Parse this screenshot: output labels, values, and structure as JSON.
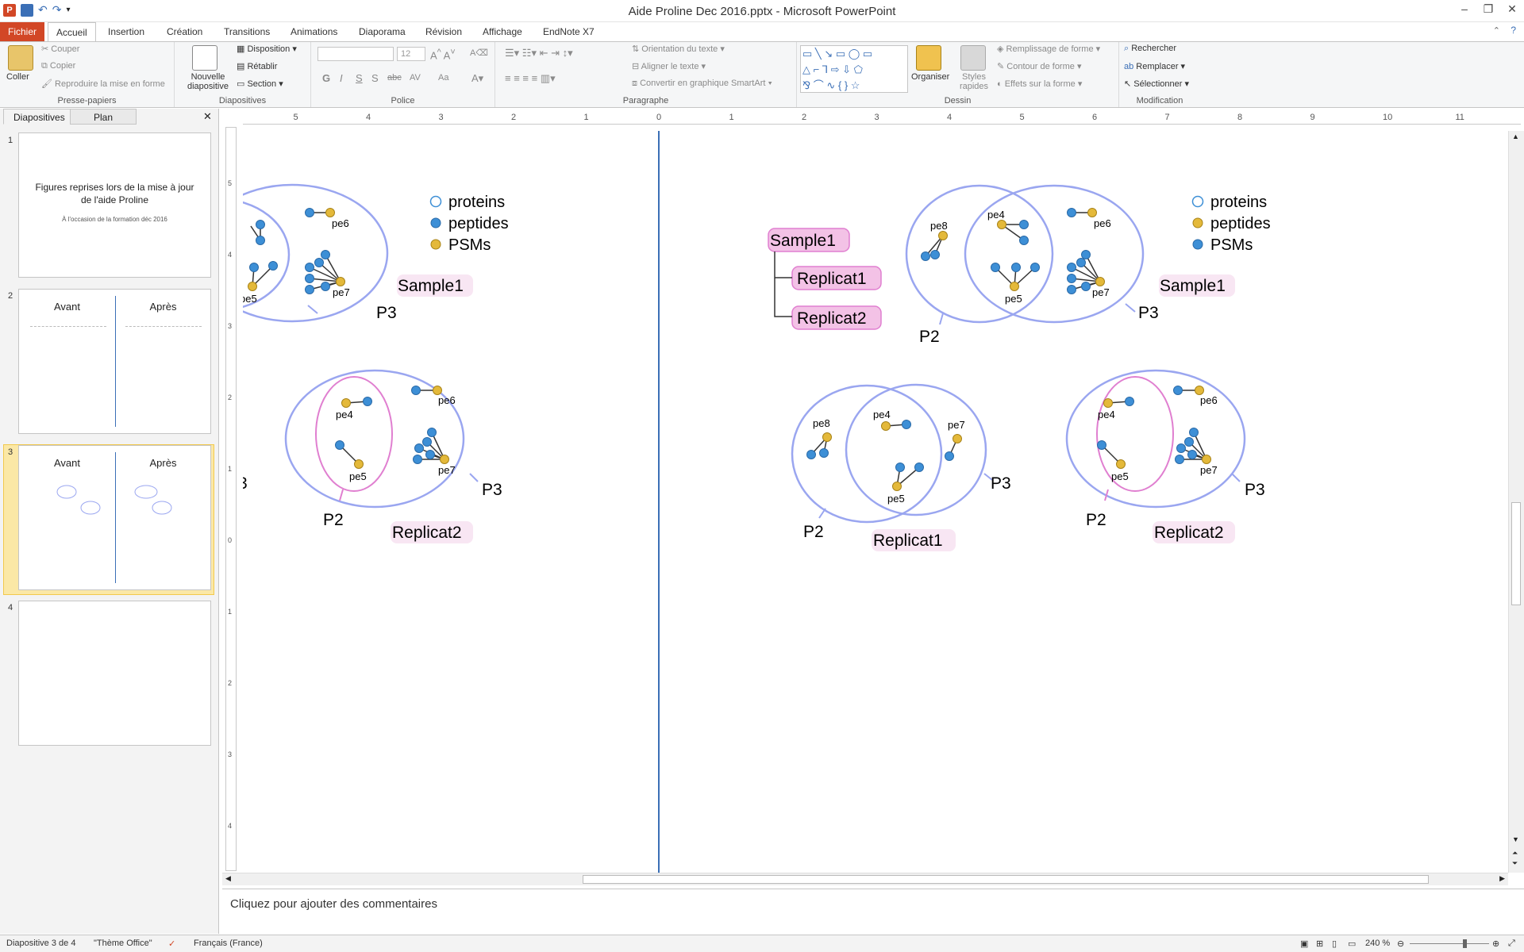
{
  "window": {
    "title": "Aide Proline Dec 2016.pptx - Microsoft PowerPoint"
  },
  "tabs": [
    "Fichier",
    "Accueil",
    "Insertion",
    "Création",
    "Transitions",
    "Animations",
    "Diaporama",
    "Révision",
    "Affichage",
    "EndNote X7"
  ],
  "ribbon": {
    "clipboard": {
      "paste": "Coller",
      "cut": "Couper",
      "copy": "Copier",
      "format_painter": "Reproduire la mise en forme",
      "label": "Presse-papiers"
    },
    "slides": {
      "new": "Nouvelle diapositive",
      "layout": "Disposition",
      "reset": "Rétablir",
      "section": "Section",
      "label": "Diapositives"
    },
    "font": {
      "size": "12",
      "bold": "G",
      "italic": "I",
      "underline": "S",
      "strike": "S",
      "shadow": "abc",
      "spacing": "AV",
      "case": "Aa",
      "label": "Police"
    },
    "paragraph": {
      "text_direction": "Orientation du texte",
      "align_text": "Aligner le texte",
      "smartart": "Convertir en graphique SmartArt",
      "label": "Paragraphe"
    },
    "drawing": {
      "arrange": "Organiser",
      "quick_styles": "Styles rapides",
      "fill": "Remplissage de forme",
      "outline": "Contour de forme",
      "effects": "Effets sur la forme",
      "label": "Dessin"
    },
    "editing": {
      "find": "Rechercher",
      "replace": "Remplacer",
      "select": "Sélectionner",
      "label": "Modification"
    }
  },
  "pane": {
    "tab_slides": "Diapositives",
    "tab_outline": "Plan",
    "slides": [
      {
        "num": "1",
        "title": "Figures reprises lors de la mise à jour de l'aide Proline",
        "subtitle": "À l'occasion de la formation déc 2016"
      },
      {
        "num": "2",
        "left": "Avant",
        "right": "Après"
      },
      {
        "num": "3",
        "left": "Avant",
        "right": "Après"
      },
      {
        "num": "4"
      }
    ]
  },
  "ruler": {
    "h_ticks": [
      "5",
      "4",
      "3",
      "2",
      "1",
      "0",
      "1",
      "2",
      "3",
      "4",
      "5",
      "6",
      "7",
      "8",
      "9",
      "10",
      "11"
    ],
    "v_ticks": [
      "5",
      "4",
      "3",
      "2",
      "1",
      "0",
      "1",
      "2",
      "3",
      "4"
    ]
  },
  "slide": {
    "legend_left": [
      "proteins",
      "peptides",
      "PSMs"
    ],
    "legend_right": [
      "proteins",
      "peptides",
      "PSMs"
    ],
    "hierarchy": [
      "Sample1",
      "Replicat1",
      "Replicat2"
    ],
    "labels": {
      "pe4": "pe4",
      "pe5": "pe5",
      "pe6": "pe6",
      "pe7": "pe7",
      "pe8": "pe8",
      "p2": "P2",
      "p3": "P3",
      "three": "3",
      "sample1": "Sample1",
      "replicat1": "Replicat1",
      "replicat2": "Replicat2"
    }
  },
  "notes": {
    "placeholder": "Cliquez pour ajouter des commentaires"
  },
  "status": {
    "slide": "Diapositive 3 de 4",
    "theme": "\"Thème Office\"",
    "lang": "Français (France)",
    "zoom": "240 %"
  },
  "colors": {
    "file_tab": "#d24726",
    "circle": "#9aa6f0",
    "pink": "#e07fd0",
    "blue_dot": "#3d8fd6",
    "yellow_dot": "#e4b93a",
    "label_bg": "#f3c2e6"
  }
}
